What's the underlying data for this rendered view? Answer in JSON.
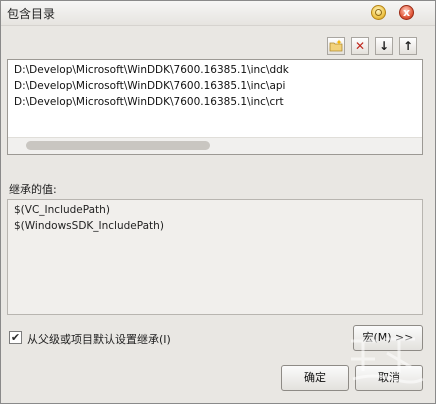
{
  "window": {
    "title": "包含目录",
    "close_glyph": "x"
  },
  "toolbar": {
    "new_icon": "new-folder-icon",
    "delete_icon": "delete-icon",
    "down_icon": "arrow-down-icon",
    "up_icon": "arrow-up-icon",
    "delete_glyph": "✕",
    "down_glyph": "↓",
    "up_glyph": "↑"
  },
  "directories": [
    "D:\\Develop\\Microsoft\\WinDDK\\7600.16385.1\\inc\\ddk",
    "D:\\Develop\\Microsoft\\WinDDK\\7600.16385.1\\inc\\api",
    "D:\\Develop\\Microsoft\\WinDDK\\7600.16385.1\\inc\\crt"
  ],
  "inherited": {
    "label": "继承的值:",
    "values": [
      "$(VC_IncludePath)",
      "$(WindowsSDK_IncludePath)"
    ]
  },
  "inherit_checkbox": {
    "label": "从父级或项目默认设置继承(I)",
    "checked": true,
    "glyph": "✔"
  },
  "buttons": {
    "macro": "宏(M) >>",
    "ok": "确定",
    "cancel": "取消"
  },
  "colors": {
    "window_bg": "#e9e7e3",
    "delete_red": "#c0281f"
  }
}
